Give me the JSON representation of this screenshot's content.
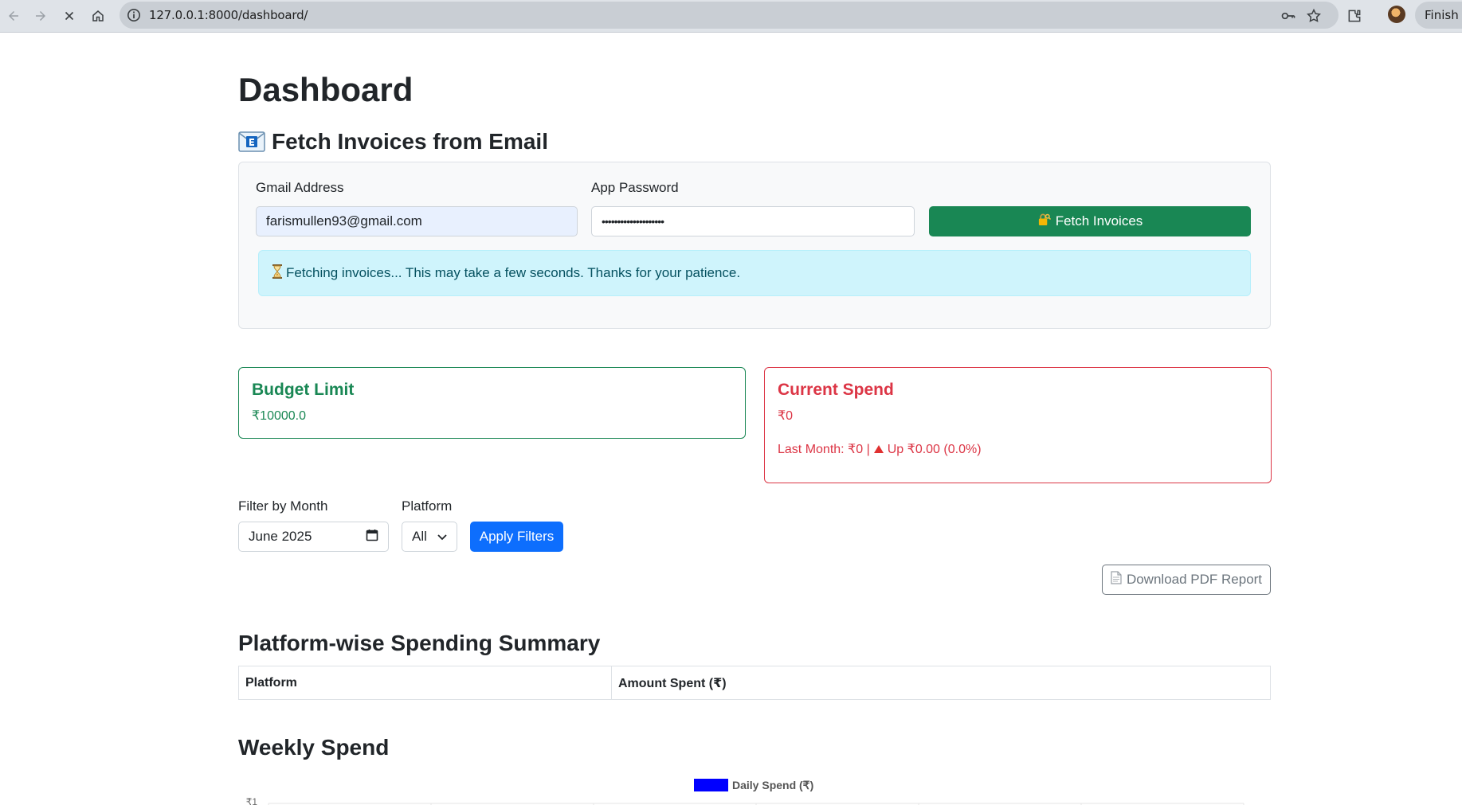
{
  "browser": {
    "url": "127.0.0.1:8000/dashboard/",
    "finish_label": "Finish u"
  },
  "page": {
    "title": "Dashboard"
  },
  "fetch": {
    "heading": "Fetch Invoices from Email",
    "email_label": "Gmail Address",
    "email_value": "farismullen93@gmail.com",
    "password_label": "App Password",
    "password_value": "••••••••••••••••••••",
    "button_label": "Fetch Invoices",
    "status_message": "Fetching invoices... This may take a few seconds. Thanks for your patience."
  },
  "budget": {
    "title": "Budget Limit",
    "value": "₹10000.0"
  },
  "spend": {
    "title": "Current Spend",
    "value": "₹0",
    "last_month": "Last Month: ₹0 |",
    "change": "Up ₹0.00 (0.0%)"
  },
  "filters": {
    "month_label": "Filter by Month",
    "month_value": "June 2025",
    "platform_label": "Platform",
    "platform_value": "All",
    "apply_label": "Apply Filters",
    "download_label": "Download PDF Report"
  },
  "summary": {
    "title": "Platform-wise Spending Summary",
    "columns": [
      "Platform",
      "Amount Spent (₹)"
    ]
  },
  "weekly": {
    "title": "Weekly Spend"
  },
  "chart_data": {
    "type": "bar",
    "categories": [],
    "series": [
      {
        "name": "Daily Spend (₹)",
        "values": [],
        "color": "#0000ff"
      }
    ],
    "y_tick_visible": "₹1",
    "grid": true,
    "legend": "top-center"
  },
  "colors": {
    "success": "#198754",
    "danger": "#dc3545",
    "primary": "#0d6efd",
    "info_bg": "#cff4fc",
    "info_text": "#055160"
  }
}
